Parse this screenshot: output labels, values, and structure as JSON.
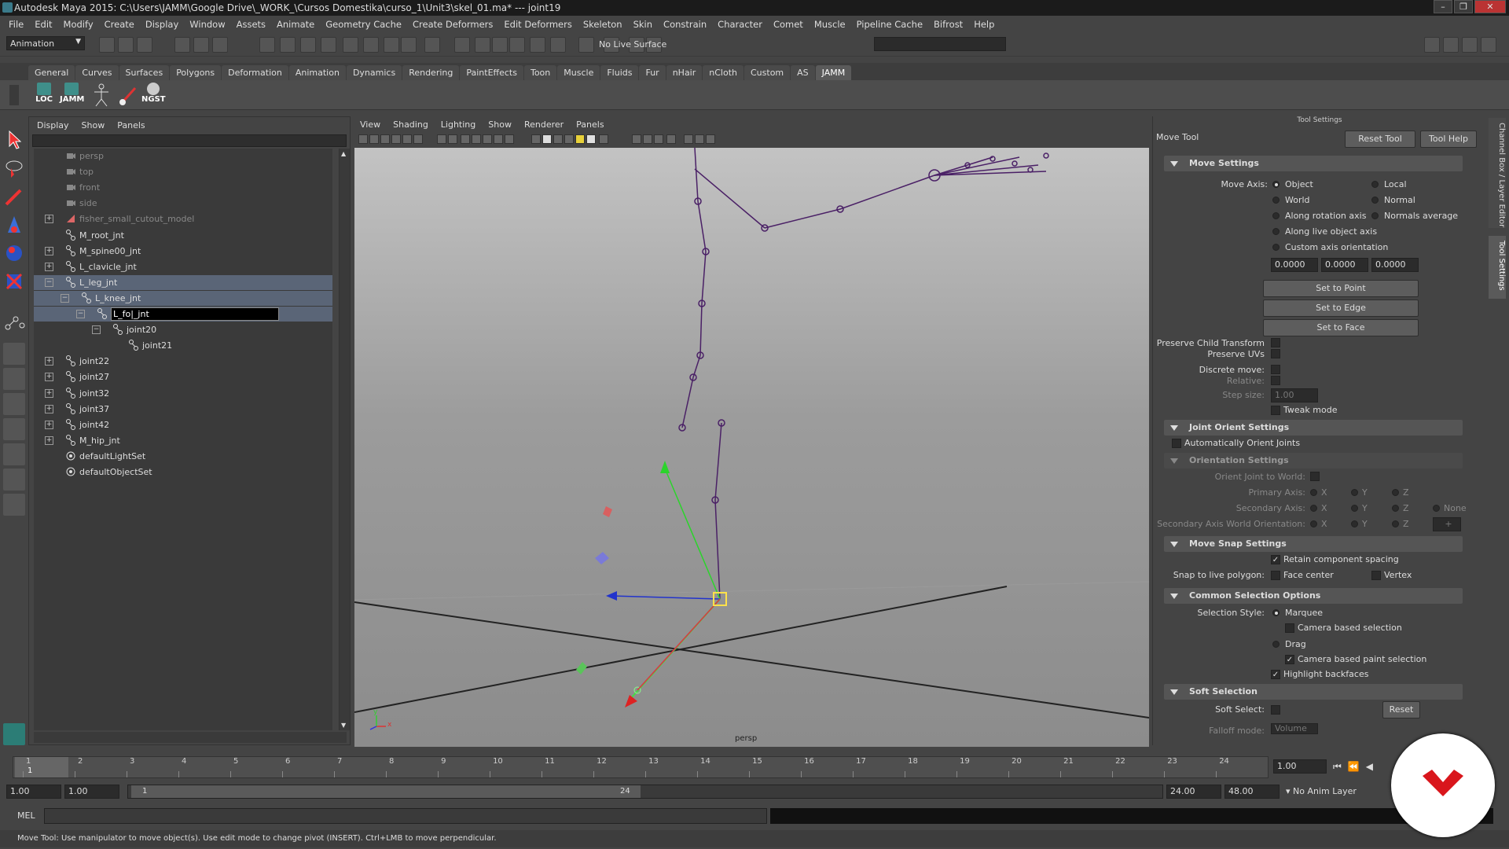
{
  "window": {
    "title": "Autodesk Maya 2015: C:\\Users\\JAMM\\Google Drive\\_WORK_\\Cursos Domestika\\curso_1\\Unit3\\skel_01.ma*   ---   joint19"
  },
  "menubar": [
    "File",
    "Edit",
    "Modify",
    "Create",
    "Display",
    "Window",
    "Assets",
    "Animate",
    "Geometry Cache",
    "Create Deformers",
    "Edit Deformers",
    "Skeleton",
    "Skin",
    "Constrain",
    "Character",
    "Comet",
    "Muscle",
    "Pipeline Cache",
    "Bifrost",
    "Help"
  ],
  "statusline": {
    "menu_set": "Animation",
    "live_surface": "No Live Surface"
  },
  "shelf_tabs": [
    "General",
    "Curves",
    "Surfaces",
    "Polygons",
    "Deformation",
    "Animation",
    "Dynamics",
    "Rendering",
    "PaintEffects",
    "Toon",
    "Muscle",
    "Fluids",
    "Fur",
    "nHair",
    "nCloth",
    "Custom",
    "AS",
    "JAMM"
  ],
  "shelf_active": "JAMM",
  "shelf_buttons": [
    "LOC",
    "JAMM",
    "",
    "",
    "NGST"
  ],
  "outliner": {
    "menu": [
      "Display",
      "Show",
      "Panels"
    ],
    "rows": [
      {
        "label": "persp"
      },
      {
        "label": "top"
      },
      {
        "label": "front"
      },
      {
        "label": "side"
      },
      {
        "label": "fisher_small_cutout_model"
      },
      {
        "label": "M_root_jnt"
      },
      {
        "label": "M_spine00_jnt"
      },
      {
        "label": "L_clavicle_jnt"
      },
      {
        "label": "L_leg_jnt"
      },
      {
        "label": "L_knee_jnt"
      },
      {
        "label": "L_fo|_jnt"
      },
      {
        "label": "joint20"
      },
      {
        "label": "joint21"
      },
      {
        "label": "joint22"
      },
      {
        "label": "joint27"
      },
      {
        "label": "joint32"
      },
      {
        "label": "joint37"
      },
      {
        "label": "joint42"
      },
      {
        "label": "M_hip_jnt"
      },
      {
        "label": "defaultLightSet"
      },
      {
        "label": "defaultObjectSet"
      }
    ]
  },
  "viewport": {
    "menu": [
      "View",
      "Shading",
      "Lighting",
      "Show",
      "Renderer",
      "Panels"
    ],
    "camera_label": "persp",
    "axis_x": "x",
    "axis_y": "y"
  },
  "tool_settings": {
    "panel_title": "Tool Settings",
    "tool_name": "Move Tool",
    "reset_button": "Reset Tool",
    "help_button": "Tool Help",
    "move_settings": {
      "header": "Move Settings",
      "axis_label": "Move Axis:",
      "axis_options": [
        "Object",
        "Local",
        "World",
        "Normal",
        "Along rotation axis",
        "Normals average",
        "Along live object axis",
        "Custom axis orientation"
      ],
      "axis_selected": "Object",
      "values": [
        "0.0000",
        "0.0000",
        "0.0000"
      ],
      "set_point": "Set to Point",
      "set_edge": "Set to Edge",
      "set_face": "Set to Face",
      "preserve_child": "Preserve Child Transform",
      "preserve_uvs": "Preserve UVs",
      "discrete_move": "Discrete move:",
      "relative": "Relative:",
      "step_size": "Step size:",
      "step_value": "1.00",
      "tweak_mode": "Tweak mode"
    },
    "joint_orient": {
      "header": "Joint Orient Settings",
      "auto_orient": "Automatically Orient Joints",
      "orientation_header": "Orientation Settings",
      "orient_world": "Orient Joint to World:",
      "primary_axis": "Primary Axis:",
      "secondary_axis": "Secondary Axis:",
      "secondary_world": "Secondary Axis World Orientation:",
      "x": "X",
      "y": "Y",
      "z": "Z",
      "none": "None",
      "plus": "+"
    },
    "snap": {
      "header": "Move Snap Settings",
      "retain": "Retain component spacing",
      "snap_label": "Snap to live polygon:",
      "face_center": "Face center",
      "vertex": "Vertex"
    },
    "selection": {
      "header": "Common Selection Options",
      "style_label": "Selection Style:",
      "marquee": "Marquee",
      "camera_based": "Camera based selection",
      "drag": "Drag",
      "camera_paint": "Camera based paint selection",
      "highlight": "Highlight backfaces"
    },
    "soft": {
      "header": "Soft Selection",
      "soft_select": "Soft Select:",
      "reset": "Reset",
      "falloff": "Falloff mode:",
      "falloff_value": "Volume"
    }
  },
  "side_tabs": [
    "Channel Box / Layer Editor",
    "Tool Settings"
  ],
  "timeline": {
    "ticks": [
      "1",
      "2",
      "3",
      "4",
      "5",
      "6",
      "7",
      "8",
      "9",
      "10",
      "11",
      "12",
      "13",
      "14",
      "15",
      "16",
      "17",
      "18",
      "19",
      "20",
      "21",
      "22",
      "23",
      "24"
    ],
    "current_frame": "1.00",
    "current_marker": "1"
  },
  "range": {
    "start": "1.00",
    "playback_start": "1.00",
    "slider_start": "1",
    "slider_end": "24",
    "playback_end": "24.00",
    "end": "48.00",
    "anim_layer": "No Anim Layer"
  },
  "command_line": {
    "label": "MEL"
  },
  "help_line": "Move Tool: Use manipulator to move object(s). Use edit mode to change pivot (INSERT).  Ctrl+LMB to move perpendicular.",
  "colors": {
    "selection": "#5a6577",
    "accent_logo": "#d9161c",
    "joint": "#5a2a7a"
  }
}
